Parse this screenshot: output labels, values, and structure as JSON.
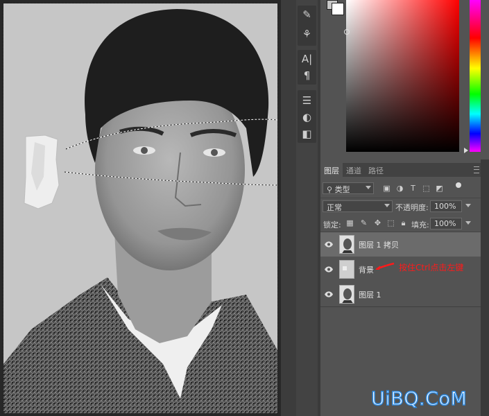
{
  "layers_panel": {
    "tabs": [
      "图层",
      "通道",
      "路径"
    ],
    "filter": {
      "label": "类型"
    },
    "blend_mode": "正常",
    "opacity_label": "不透明度:",
    "opacity_value": "100%",
    "lock_label": "锁定:",
    "fill_label": "填充:",
    "fill_value": "100%",
    "layers": [
      {
        "name": "图层 1 拷贝",
        "selected": true,
        "visible": true
      },
      {
        "name": "背景",
        "selected": false,
        "visible": true
      },
      {
        "name": "图层 1",
        "selected": false,
        "visible": true
      }
    ]
  },
  "annotation": "按住Ctrl点击左键",
  "watermark": "UiBQ.CoM",
  "colors": {
    "panel": "#535353",
    "selected_layer": "#6b6b6b",
    "annotation": "#ff1a1a",
    "watermark_stroke": "#2d8ce6"
  },
  "tools": [
    "brush-presets-icon",
    "clone-source-icon",
    "character-icon",
    "paragraph-icon",
    "adjustments-icon",
    "styles-icon",
    "properties-icon"
  ]
}
